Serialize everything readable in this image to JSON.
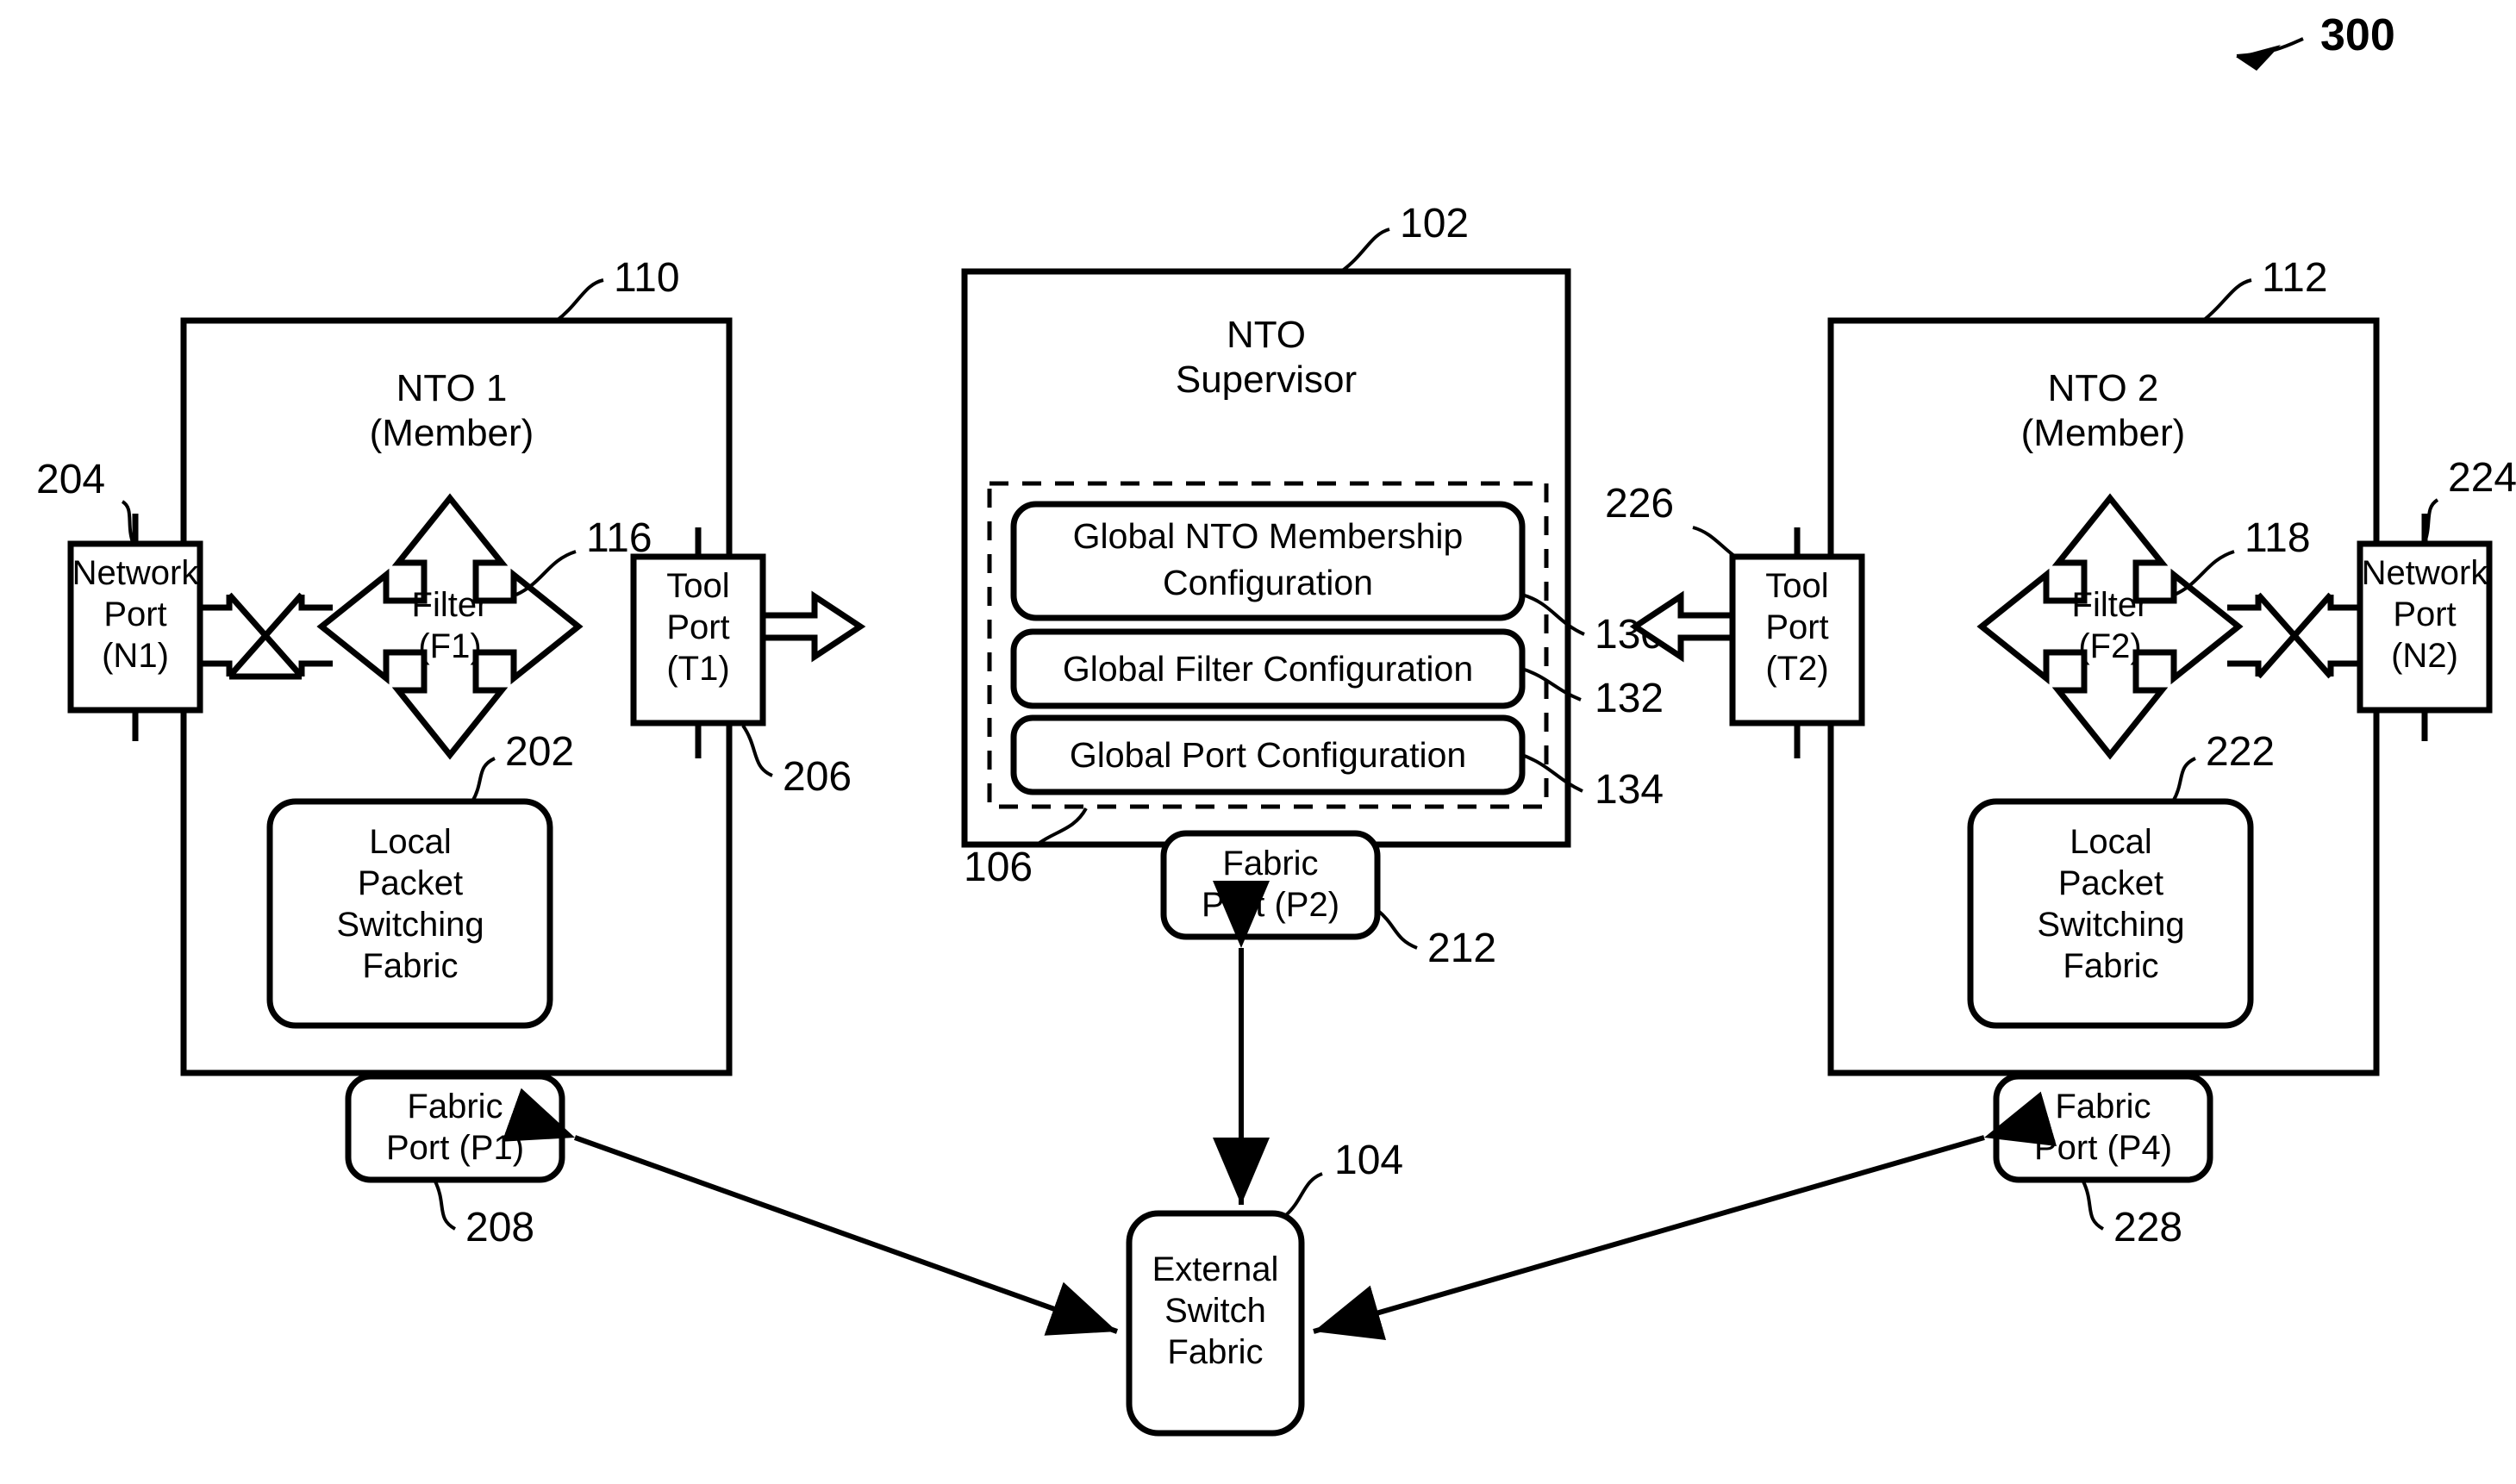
{
  "figure": {
    "number": "300"
  },
  "nto1": {
    "title_line1": "NTO 1",
    "title_line2": "(Member)",
    "ref": "110",
    "network_port": {
      "line1": "Network",
      "line2": "Port",
      "line3": "(N1)",
      "ref": "204"
    },
    "filter": {
      "line1": "Filter",
      "line2": "(F1)",
      "ref": "116"
    },
    "tool_port": {
      "line1": "Tool",
      "line2": "Port",
      "line3": "(T1)",
      "ref": "206"
    },
    "local_fabric": {
      "line1": "Local",
      "line2": "Packet",
      "line3": "Switching",
      "line4": "Fabric",
      "ref": "202"
    },
    "fabric_port": {
      "line1": "Fabric",
      "line2": "Port (P1)",
      "ref": "208"
    }
  },
  "supervisor": {
    "title_line1": "NTO",
    "title_line2": "Supervisor",
    "ref": "102",
    "config_group_ref": "106",
    "configs": [
      {
        "line1": "Global NTO Membership",
        "line2": "Configuration",
        "ref": "130"
      },
      {
        "line1": "Global Filter Configuration",
        "line2": "",
        "ref": "132"
      },
      {
        "line1": "Global Port Configuration",
        "line2": "",
        "ref": "134"
      }
    ],
    "fabric_port": {
      "line1": "Fabric",
      "line2": "Port (P2)",
      "ref": "212"
    }
  },
  "nto2": {
    "title_line1": "NTO 2",
    "title_line2": "(Member)",
    "ref": "112",
    "network_port": {
      "line1": "Network",
      "line2": "Port",
      "line3": "(N2)",
      "ref": "224"
    },
    "filter": {
      "line1": "Filter",
      "line2": "(F2)",
      "ref": "118"
    },
    "tool_port": {
      "line1": "Tool",
      "line2": "Port",
      "line3": "(T2)",
      "ref": "226"
    },
    "local_fabric": {
      "line1": "Local",
      "line2": "Packet",
      "line3": "Switching",
      "line4": "Fabric",
      "ref": "222"
    },
    "fabric_port": {
      "line1": "Fabric",
      "line2": "Port (P4)",
      "ref": "228"
    }
  },
  "external_switch": {
    "line1": "External",
    "line2": "Switch",
    "line3": "Fabric",
    "ref": "104"
  },
  "colors": {
    "ink": "#000000",
    "paper": "#ffffff"
  }
}
